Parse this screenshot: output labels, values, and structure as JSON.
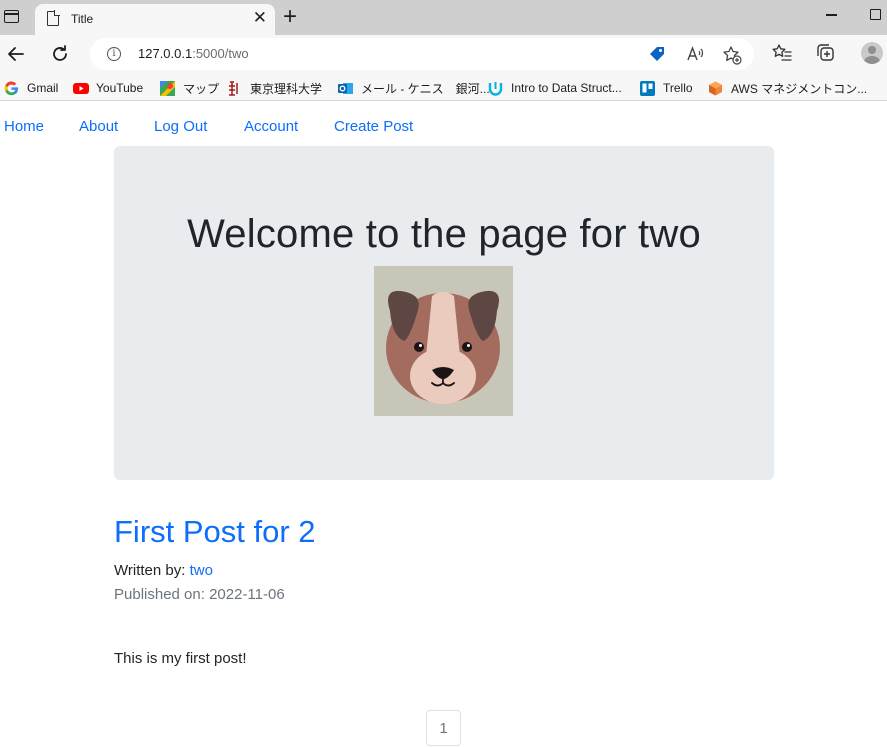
{
  "browser": {
    "tab_title": "Title",
    "tab_close": "✕",
    "new_tab": "+",
    "url_host": "127.0.0.1",
    "url_rest": ":5000/two",
    "bookmarks": [
      {
        "label": "Gmail",
        "icon": "google-icon"
      },
      {
        "label": "YouTube",
        "icon": "youtube-icon"
      },
      {
        "label": "マップ",
        "icon": "maps-icon"
      },
      {
        "label": "東京理科大学",
        "icon": "university-icon"
      },
      {
        "label": "メール - ケニス　銀河...",
        "icon": "outlook-icon"
      },
      {
        "label": "Intro to Data Struct...",
        "icon": "udacity-icon"
      },
      {
        "label": "Trello",
        "icon": "trello-icon"
      },
      {
        "label": "AWS マネジメントコン...",
        "icon": "aws-icon"
      }
    ]
  },
  "nav": {
    "links": [
      "Home",
      "About",
      "Log Out",
      "Account",
      "Create Post"
    ]
  },
  "jumbotron": {
    "title": "Welcome to the page for two",
    "image": "dog-avatar"
  },
  "post": {
    "title": "First Post for 2",
    "written_by_label": "Written by: ",
    "author": "two",
    "published": "Published on: 2022-11-06",
    "content": "This is my first post!"
  },
  "pagination": {
    "pages": [
      "1"
    ]
  },
  "colors": {
    "link": "#0d6efd",
    "jumbotron_bg": "#e9ecef",
    "text": "#212529",
    "muted": "#6c757d"
  }
}
